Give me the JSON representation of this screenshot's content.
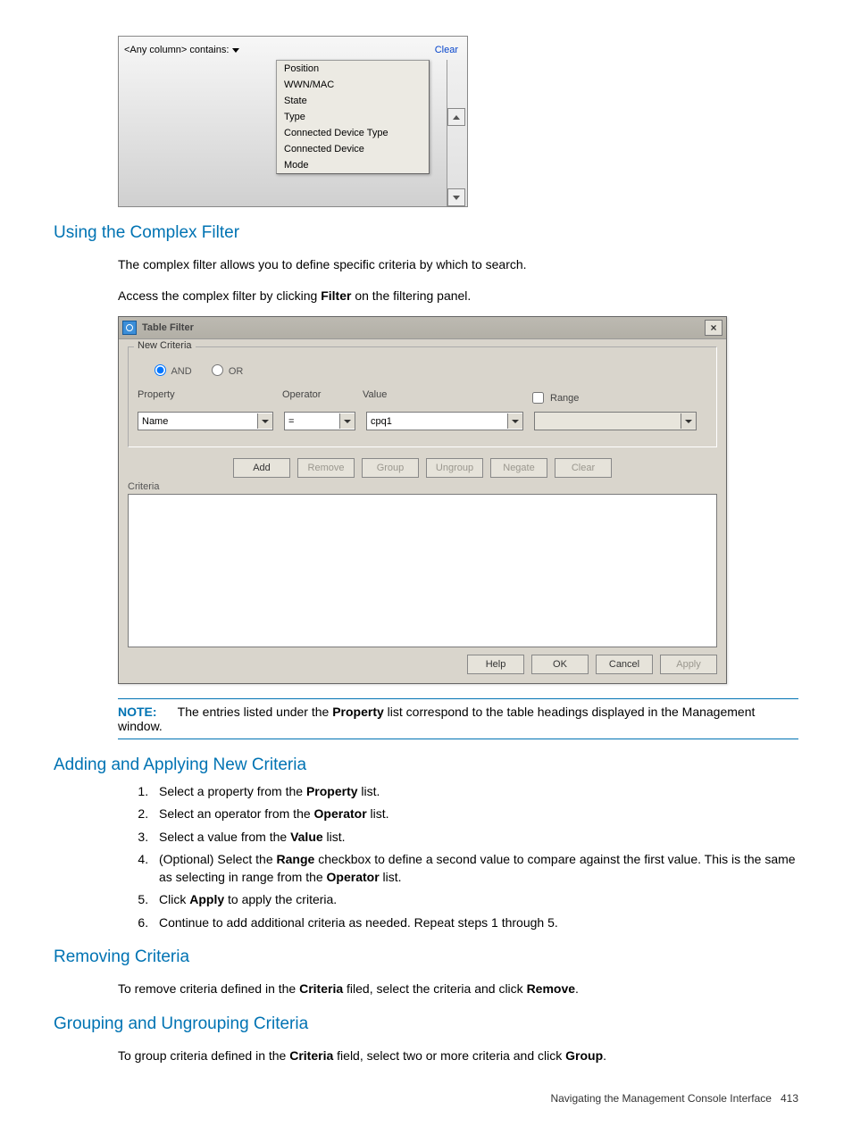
{
  "shot1": {
    "filter_label": "<Any column> contains:",
    "clear": "Clear",
    "options": [
      "Position",
      "WWN/MAC",
      "State",
      "Type",
      "Connected Device Type",
      "Connected Device",
      "Mode"
    ]
  },
  "sections": {
    "using_title": "Using the Complex Filter",
    "using_p1": "The complex filter allows you to define specific criteria by which to search.",
    "using_p2a": "Access the complex filter by clicking ",
    "using_p2_bold": "Filter",
    "using_p2b": " on the filtering panel.",
    "adding_title": "Adding and Applying New Criteria",
    "removing_title": "Removing Criteria",
    "grouping_title": "Grouping and Ungrouping Criteria"
  },
  "note": {
    "label": "NOTE:",
    "text_a": "The entries listed under the ",
    "text_bold": "Property",
    "text_b": " list correspond to the table headings displayed in the Management window."
  },
  "steps": {
    "s1a": "Select a property from the ",
    "s1b": "Property",
    "s1c": " list.",
    "s2a": "Select an operator from the ",
    "s2b": "Operator",
    "s2c": " list.",
    "s3a": "Select a value from the ",
    "s3b": "Value",
    "s3c": " list.",
    "s4a": "(Optional) Select the ",
    "s4b": "Range",
    "s4c": " checkbox to define a second value to compare against the first value. This is the same as selecting in range from the ",
    "s4d": "Operator",
    "s4e": " list.",
    "s5a": "Click ",
    "s5b": "Apply",
    "s5c": " to apply the criteria.",
    "s6": "Continue to add additional criteria as needed. Repeat steps 1 through 5."
  },
  "removing": {
    "a": "To remove criteria defined in the ",
    "b": "Criteria",
    "c": " filed, select the criteria and click ",
    "d": "Remove",
    "e": "."
  },
  "grouping": {
    "a": "To group criteria defined in the ",
    "b": "Criteria",
    "c": " field, select two or more criteria and click ",
    "d": "Group",
    "e": "."
  },
  "dialog": {
    "title": "Table Filter",
    "group_title": "New Criteria",
    "and": "AND",
    "or": "OR",
    "property_label": "Property",
    "operator_label": "Operator",
    "value_label": "Value",
    "range_label": "Range",
    "property_value": "Name",
    "operator_value": "=",
    "value_value": "cpq1",
    "range_value": "",
    "buttons": {
      "add": "Add",
      "remove": "Remove",
      "group": "Group",
      "ungroup": "Ungroup",
      "negate": "Negate",
      "clear": "Clear"
    },
    "criteria_label": "Criteria",
    "footer": {
      "help": "Help",
      "ok": "OK",
      "cancel": "Cancel",
      "apply": "Apply"
    }
  },
  "footer": {
    "text": "Navigating the Management Console Interface",
    "page": "413"
  }
}
